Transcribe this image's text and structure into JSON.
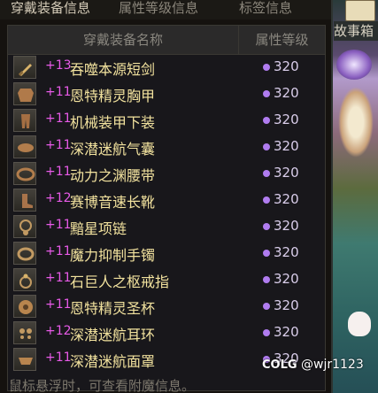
{
  "tabs": [
    "穿戴装备信息",
    "属性等级信息",
    "标签信息"
  ],
  "table": {
    "col_name": "穿戴装备名称",
    "col_attr": "属性等级"
  },
  "rows": [
    {
      "level": "+13",
      "name": "吞噬本源短剑",
      "value": "320",
      "icon": "dagger-icon",
      "level_color": "#e85ae8"
    },
    {
      "level": "+11",
      "name": "恩特精灵胸甲",
      "value": "320",
      "icon": "chest-armor-icon",
      "level_color": "#e85ae8"
    },
    {
      "level": "+11",
      "name": "机械装甲下装",
      "value": "320",
      "icon": "leg-armor-icon",
      "level_color": "#e85ae8"
    },
    {
      "level": "+11",
      "name": "深潜迷航气囊",
      "value": "320",
      "icon": "shoulder-icon",
      "level_color": "#e85ae8"
    },
    {
      "level": "+11",
      "name": "动力之渊腰带",
      "value": "320",
      "icon": "belt-icon",
      "level_color": "#e85ae8"
    },
    {
      "level": "+12",
      "name": "赛博音速长靴",
      "value": "320",
      "icon": "boots-icon",
      "level_color": "#e85ae8"
    },
    {
      "level": "+11",
      "name": "黯星项链",
      "value": "320",
      "icon": "necklace-icon",
      "level_color": "#e85ae8"
    },
    {
      "level": "+11",
      "name": "魔力抑制手镯",
      "value": "320",
      "icon": "bracelet-icon",
      "level_color": "#e85ae8"
    },
    {
      "level": "+11",
      "name": "石巨人之枢戒指",
      "value": "320",
      "icon": "ring-icon",
      "level_color": "#e85ae8"
    },
    {
      "level": "+11",
      "name": "恩特精灵圣杯",
      "value": "320",
      "icon": "chalice-icon",
      "level_color": "#e85ae8"
    },
    {
      "level": "+12",
      "name": "深潜迷航耳环",
      "value": "320",
      "icon": "earring-icon",
      "level_color": "#e85ae8"
    },
    {
      "level": "+11",
      "name": "深潜迷航面罩",
      "value": "320",
      "icon": "mask-icon",
      "level_color": "#e85ae8"
    }
  ],
  "footer_text": "鼠标悬浮时，可查看附魔信息。",
  "side": {
    "story_label": "故事箱"
  },
  "watermark": {
    "logo": "COLG",
    "handle": "@wjr1123"
  },
  "colors": {
    "value_dot": "#b07cf0",
    "item_name": "#f2e29e",
    "level_plus": "#e85ae8"
  }
}
